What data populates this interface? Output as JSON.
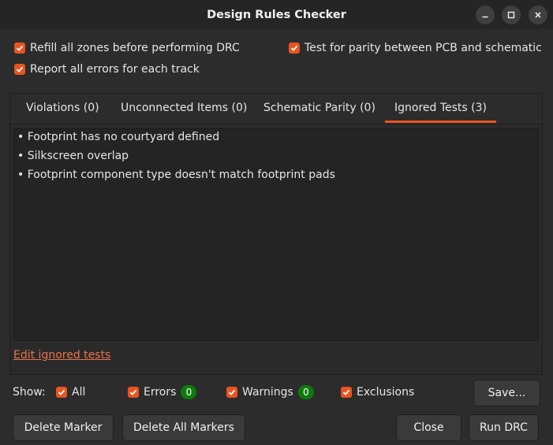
{
  "window": {
    "title": "Design Rules Checker",
    "controls": [
      "minimize-icon",
      "maximize-icon",
      "close-icon"
    ]
  },
  "options": {
    "refill_zones": {
      "label": "Refill all zones before performing DRC",
      "checked": true
    },
    "test_parity": {
      "label": "Test for parity between PCB and schematic",
      "checked": true
    },
    "report_all_errors": {
      "label": "Report all errors for each track",
      "checked": true
    }
  },
  "tabs": [
    {
      "label": "Violations (0)",
      "active": false
    },
    {
      "label": "Unconnected Items (0)",
      "active": false
    },
    {
      "label": "Schematic Parity (0)",
      "active": false
    },
    {
      "label": "Ignored Tests (3)",
      "active": true
    }
  ],
  "ignored_tests": [
    "• Footprint has no courtyard defined",
    "• Silkscreen overlap",
    "• Footprint component type doesn't match footprint pads"
  ],
  "edit_link": "Edit ignored tests",
  "filter": {
    "show_label": "Show:",
    "all": {
      "label": "All",
      "checked": true
    },
    "errors": {
      "label": "Errors",
      "checked": true,
      "count": "0"
    },
    "warnings": {
      "label": "Warnings",
      "checked": true,
      "count": "0"
    },
    "exclusions": {
      "label": "Exclusions",
      "checked": true
    }
  },
  "buttons": {
    "save": "Save...",
    "delete_marker": "Delete Marker",
    "delete_all_markers": "Delete All Markers",
    "close": "Close",
    "run_drc": "Run DRC"
  },
  "colors": {
    "accent": "#e95420",
    "badge": "#0e7a0d",
    "link": "#e8734d",
    "background": "#2c2c2c"
  }
}
